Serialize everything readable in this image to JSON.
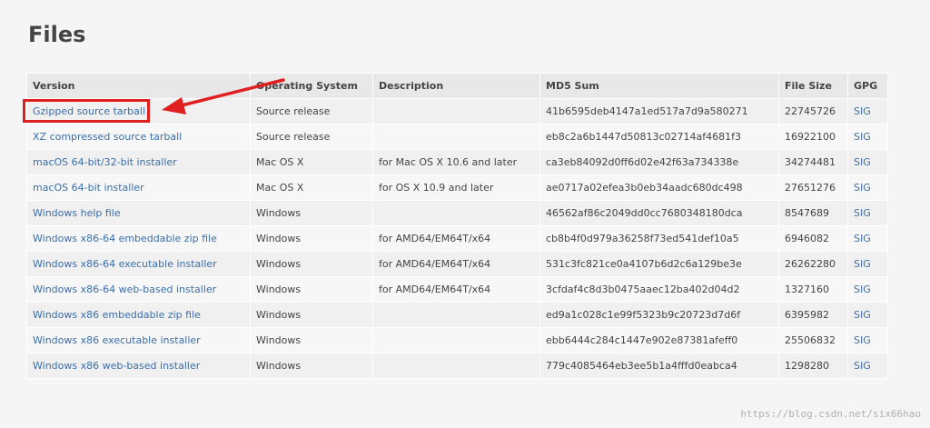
{
  "heading": "Files",
  "table": {
    "headers": [
      "Version",
      "Operating System",
      "Description",
      "MD5 Sum",
      "File Size",
      "GPG"
    ],
    "rows": [
      {
        "version": "Gzipped source tarball",
        "os": "Source release",
        "description": "",
        "md5": "41b6595deb4147a1ed517a7d9a580271",
        "size": "22745726",
        "gpg": "SIG"
      },
      {
        "version": "XZ compressed source tarball",
        "os": "Source release",
        "description": "",
        "md5": "eb8c2a6b1447d50813c02714af4681f3",
        "size": "16922100",
        "gpg": "SIG"
      },
      {
        "version": "macOS 64-bit/32-bit installer",
        "os": "Mac OS X",
        "description": "for Mac OS X 10.6 and later",
        "md5": "ca3eb84092d0ff6d02e42f63a734338e",
        "size": "34274481",
        "gpg": "SIG"
      },
      {
        "version": "macOS 64-bit installer",
        "os": "Mac OS X",
        "description": "for OS X 10.9 and later",
        "md5": "ae0717a02efea3b0eb34aadc680dc498",
        "size": "27651276",
        "gpg": "SIG"
      },
      {
        "version": "Windows help file",
        "os": "Windows",
        "description": "",
        "md5": "46562af86c2049dd0cc7680348180dca",
        "size": "8547689",
        "gpg": "SIG"
      },
      {
        "version": "Windows x86-64 embeddable zip file",
        "os": "Windows",
        "description": "for AMD64/EM64T/x64",
        "md5": "cb8b4f0d979a36258f73ed541def10a5",
        "size": "6946082",
        "gpg": "SIG"
      },
      {
        "version": "Windows x86-64 executable installer",
        "os": "Windows",
        "description": "for AMD64/EM64T/x64",
        "md5": "531c3fc821ce0a4107b6d2c6a129be3e",
        "size": "26262280",
        "gpg": "SIG"
      },
      {
        "version": "Windows x86-64 web-based installer",
        "os": "Windows",
        "description": "for AMD64/EM64T/x64",
        "md5": "3cfdaf4c8d3b0475aaec12ba402d04d2",
        "size": "1327160",
        "gpg": "SIG"
      },
      {
        "version": "Windows x86 embeddable zip file",
        "os": "Windows",
        "description": "",
        "md5": "ed9a1c028c1e99f5323b9c20723d7d6f",
        "size": "6395982",
        "gpg": "SIG"
      },
      {
        "version": "Windows x86 executable installer",
        "os": "Windows",
        "description": "",
        "md5": "ebb6444c284c1447e902e87381afeff0",
        "size": "25506832",
        "gpg": "SIG"
      },
      {
        "version": "Windows x86 web-based installer",
        "os": "Windows",
        "description": "",
        "md5": "779c4085464eb3ee5b1a4fffd0eabca4",
        "size": "1298280",
        "gpg": "SIG"
      }
    ]
  },
  "annotation": {
    "color": "#e02020",
    "icon": "arrow-icon"
  },
  "colors": {
    "link": "#3b6ea8",
    "text": "#444444",
    "header_bg": "#e8e8e8"
  },
  "watermark": "https://blog.csdn.net/six66hao"
}
